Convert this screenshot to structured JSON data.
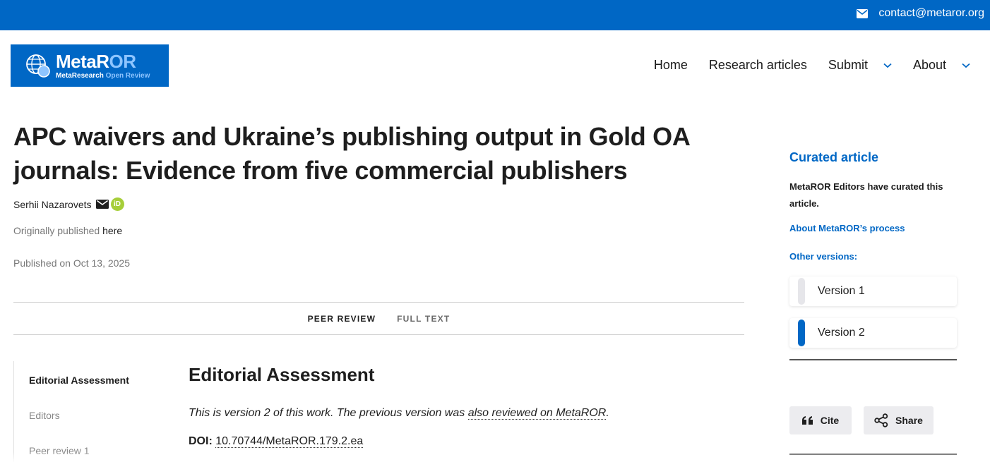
{
  "topbar": {
    "contact_email": "contact@metaror.org",
    "icon": "envelope-icon"
  },
  "logo": {
    "name_main": "MetaR",
    "name_accent": "OR",
    "tagline_main": "MetaResearch",
    "tagline_accent": "Open Review"
  },
  "nav": {
    "items": [
      {
        "label": "Home",
        "has_dropdown": false
      },
      {
        "label": "Research articles",
        "has_dropdown": false
      },
      {
        "label": "Submit",
        "has_dropdown": true
      },
      {
        "label": "About",
        "has_dropdown": true
      }
    ]
  },
  "article": {
    "title": "APC waivers and Ukraine’s publishing output in Gold OA journals: Evidence from five commercial publishers",
    "author": "Serhii Nazarovets",
    "orcid_label": "iD",
    "originally_published_prefix": "Originally published",
    "originally_published_link": "here",
    "published_date": "Published on Oct 13, 2025"
  },
  "tabs": [
    {
      "label": "PEER REVIEW",
      "active": true
    },
    {
      "label": "FULL TEXT",
      "active": false
    }
  ],
  "toc": [
    {
      "label": "Editorial Assessment",
      "active": true
    },
    {
      "label": "Editors",
      "active": false
    },
    {
      "label": "Peer review 1",
      "active": false
    }
  ],
  "section": {
    "title": "Editorial Assessment",
    "version_note_prefix": "This is version 2 of this work. The previous version was ",
    "version_note_link": "also reviewed on MetaROR",
    "version_note_suffix": ".",
    "doi_label": "DOI:",
    "doi_value": "10.70744/MetaROR.179.2.ea"
  },
  "sidebar": {
    "curated_title": "Curated article",
    "curated_text": "MetaROR Editors have curated this article.",
    "process_link": "About MetaROR’s process",
    "other_versions_label": "Other versions:",
    "versions": [
      {
        "label": "Version 1",
        "active": false
      },
      {
        "label": "Version 2",
        "active": true
      }
    ],
    "cite_label": "Cite",
    "share_label": "Share"
  },
  "colors": {
    "brand": "#0067c5",
    "accent_light": "#8ec5ff",
    "orcid": "#a6ce39"
  }
}
